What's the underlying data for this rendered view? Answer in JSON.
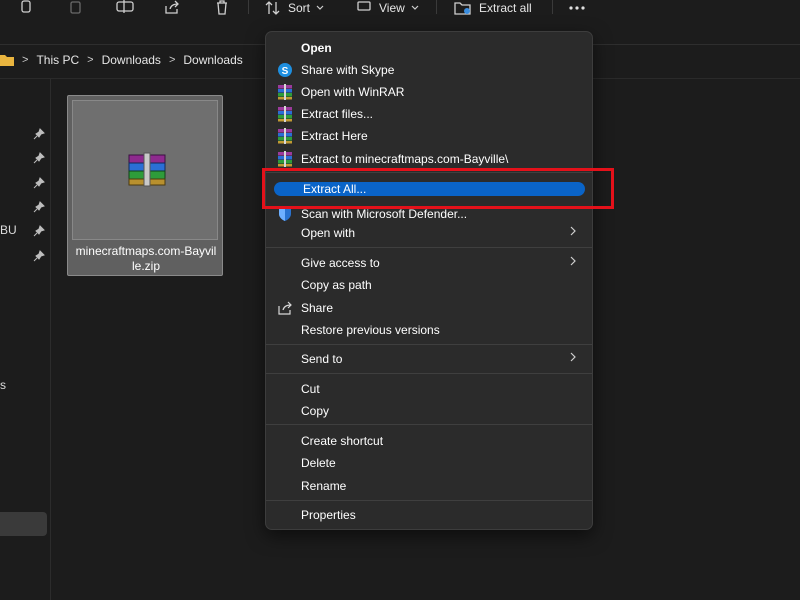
{
  "toolbar": {
    "sort_label": "Sort",
    "view_label": "View",
    "extract_all_label": "Extract all",
    "icons": [
      "copy-icon",
      "paste-icon",
      "rename-icon",
      "share-icon",
      "delete-icon",
      "sort-icon",
      "view-icon",
      "extract-all-icon",
      "more-icon"
    ]
  },
  "breadcrumb": {
    "items": [
      "This PC",
      "Downloads",
      "Downloads"
    ],
    "separator": ">"
  },
  "nav_pane": {
    "fragments": [
      "BU",
      "s"
    ]
  },
  "file": {
    "name_line1": "minecraftmaps.com-Bayvil",
    "name_line2": "le.zip"
  },
  "context_menu": {
    "items": [
      {
        "label": "Open",
        "icon": "none",
        "bold": true
      },
      {
        "label": "Share with Skype",
        "icon": "skype-icon"
      },
      {
        "label": "Open with WinRAR",
        "icon": "winrar-icon"
      },
      {
        "label": "Extract files...",
        "icon": "winrar-icon"
      },
      {
        "label": "Extract Here",
        "icon": "winrar-icon"
      },
      {
        "label": "Extract to minecraftmaps.com-Bayville\\",
        "icon": "winrar-icon"
      },
      {
        "label": "Extract All...",
        "icon": "none",
        "highlighted": true
      },
      {
        "label": "Scan with Microsoft Defender...",
        "icon": "defender-icon"
      },
      {
        "label": "Open with",
        "icon": "none",
        "submenu": true
      },
      {
        "label": "Give access to",
        "icon": "none",
        "submenu": true
      },
      {
        "label": "Copy as path",
        "icon": "none"
      },
      {
        "label": "Share",
        "icon": "share-icon"
      },
      {
        "label": "Restore previous versions",
        "icon": "none"
      },
      {
        "label": "Send to",
        "icon": "none",
        "submenu": true
      },
      {
        "label": "Cut",
        "icon": "none"
      },
      {
        "label": "Copy",
        "icon": "none"
      },
      {
        "label": "Create shortcut",
        "icon": "none"
      },
      {
        "label": "Delete",
        "icon": "none"
      },
      {
        "label": "Rename",
        "icon": "none"
      },
      {
        "label": "Properties",
        "icon": "none"
      }
    ]
  },
  "colors": {
    "background": "#1c1c1c",
    "menu_background": "#2b2b2b",
    "highlight_blue": "#0a64c8",
    "annotation_red": "#e4111a",
    "tile_gray": "#606060"
  }
}
